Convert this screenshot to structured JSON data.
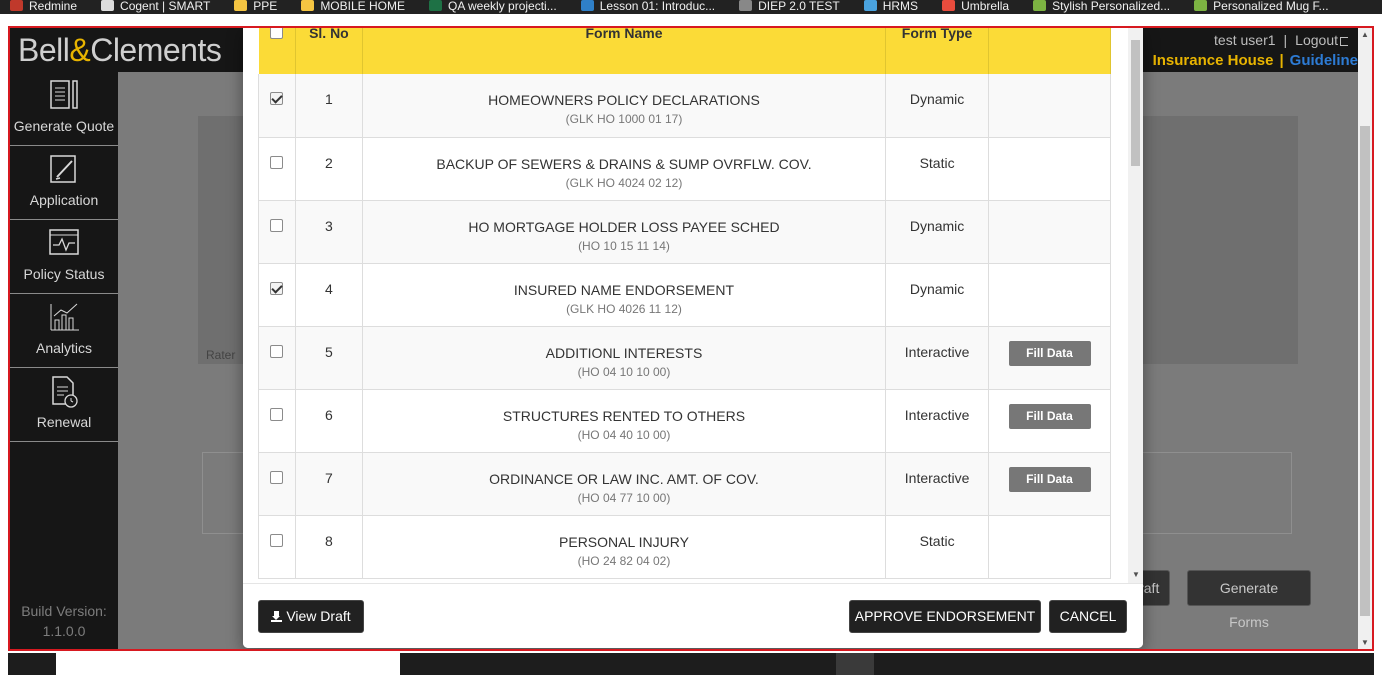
{
  "bookmarks": [
    {
      "label": "Redmine",
      "icon": "redmine-icon",
      "color": "#c0392b"
    },
    {
      "label": "Cogent | SMART",
      "icon": "globe-icon",
      "color": "#dddddd"
    },
    {
      "label": "PPE",
      "icon": "folder-icon",
      "color": "#f5c542"
    },
    {
      "label": "MOBILE HOME",
      "icon": "folder-icon",
      "color": "#f5c542"
    },
    {
      "label": "QA weekly projecti...",
      "icon": "excel-icon",
      "color": "#1e7145"
    },
    {
      "label": "Lesson 01: Introduc...",
      "icon": "cloud-icon",
      "color": "#2f80c8"
    },
    {
      "label": "DIEP 2.0 TEST",
      "icon": "app-icon",
      "color": "#888888"
    },
    {
      "label": "HRMS",
      "icon": "hrms-icon",
      "color": "#4aa3df"
    },
    {
      "label": "Umbrella",
      "icon": "umbrella-icon",
      "color": "#e84c3d"
    },
    {
      "label": "Stylish Personalized...",
      "icon": "leaf-icon",
      "color": "#7cb342"
    },
    {
      "label": "Personalized Mug F...",
      "icon": "leaf-icon",
      "color": "#7cb342"
    }
  ],
  "header": {
    "logo_left": "Bell",
    "logo_amp": "&",
    "logo_right": "Clements",
    "user": "test user1",
    "separator": "|",
    "logout": "Logout",
    "brand_house": "Insurance House",
    "brand_guidelines": "Guideline"
  },
  "sidebar": {
    "items": [
      {
        "label": "Generate Quote",
        "icon": "quote-document-icon"
      },
      {
        "label": "Application",
        "icon": "edit-application-icon"
      },
      {
        "label": "Policy Status",
        "icon": "policy-status-monitor-icon"
      },
      {
        "label": "Analytics",
        "icon": "analytics-chart-icon"
      },
      {
        "label": "Renewal",
        "icon": "renewal-document-icon"
      }
    ],
    "build_label": "Build Version:",
    "build_value": "1.1.0.0"
  },
  "background": {
    "rater_label": "Rater",
    "draft_button": "Draft",
    "generate_forms_button": "Generate Forms"
  },
  "modal": {
    "columns": {
      "select": "",
      "sl_no": "Sl. No",
      "form_name": "Form Name",
      "form_type": "Form Type",
      "action": ""
    },
    "rows": [
      {
        "checked": true,
        "sl": "1",
        "name": "HOMEOWNERS POLICY DECLARATIONS",
        "code": "(GLK HO 1000 01 17)",
        "type": "Dynamic",
        "action": ""
      },
      {
        "checked": false,
        "sl": "2",
        "name": "BACKUP OF SEWERS & DRAINS & SUMP OVRFLW. COV.",
        "code": "(GLK HO 4024 02 12)",
        "type": "Static",
        "action": ""
      },
      {
        "checked": false,
        "sl": "3",
        "name": "HO MORTGAGE HOLDER LOSS PAYEE SCHED",
        "code": "(HO 10 15 11 14)",
        "type": "Dynamic",
        "action": ""
      },
      {
        "checked": true,
        "sl": "4",
        "name": "INSURED NAME ENDORSEMENT",
        "code": "(GLK HO 4026 11 12)",
        "type": "Dynamic",
        "action": ""
      },
      {
        "checked": false,
        "sl": "5",
        "name": "ADDITIONL INTERESTS",
        "code": "(HO 04 10 10 00)",
        "type": "Interactive",
        "action": "Fill Data"
      },
      {
        "checked": false,
        "sl": "6",
        "name": "STRUCTURES RENTED TO OTHERS",
        "code": "(HO 04 40 10 00)",
        "type": "Interactive",
        "action": "Fill Data"
      },
      {
        "checked": false,
        "sl": "7",
        "name": "ORDINANCE OR LAW INC. AMT. OF COV.",
        "code": "(HO 04 77 10 00)",
        "type": "Interactive",
        "action": "Fill Data"
      },
      {
        "checked": false,
        "sl": "8",
        "name": "PERSONAL INJURY",
        "code": "(HO 24 82 04 02)",
        "type": "Static",
        "action": ""
      }
    ],
    "footer": {
      "view_draft": "View Draft",
      "approve": "APPROVE ENDORSEMENT",
      "cancel": "CANCEL"
    }
  },
  "colors": {
    "table_header": "#fbdb37",
    "accent_gold": "#e8b400",
    "accent_blue": "#2d7bd4",
    "frame_border": "#d71920",
    "button_dark": "#212121",
    "fill_button": "#777777"
  }
}
